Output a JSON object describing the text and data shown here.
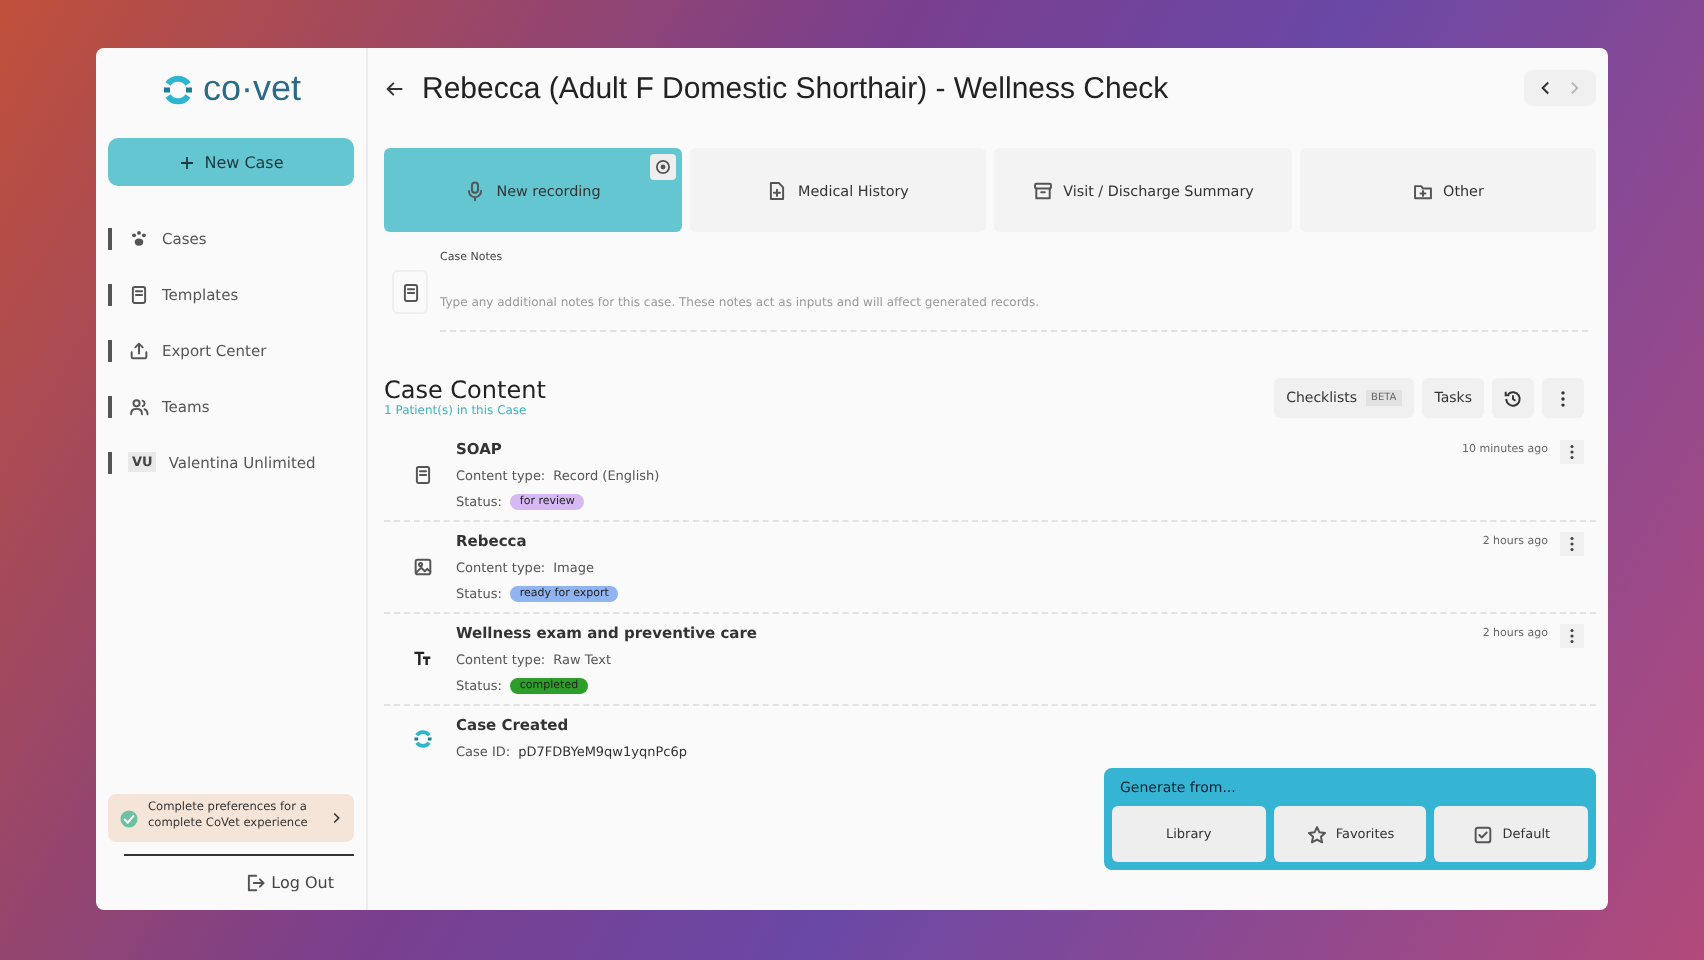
{
  "sidebar": {
    "logo": "co·vet",
    "new_case": "New Case",
    "items": [
      {
        "label": "Cases",
        "kind": "paw"
      },
      {
        "label": "Templates",
        "kind": "doc"
      },
      {
        "label": "Export Center",
        "kind": "upload"
      },
      {
        "label": "Teams",
        "kind": "people"
      },
      {
        "label": "Valentina Unlimited",
        "kind": "initials",
        "initials": "VU"
      }
    ],
    "promo": "Complete preferences for a complete CoVet experience",
    "logout": "Log Out"
  },
  "header": {
    "title": "Rebecca (Adult  F Domestic Shorthair) - Wellness Check"
  },
  "actions": [
    {
      "label": "New recording",
      "kind": "mic",
      "selected": true
    },
    {
      "label": "Medical History",
      "kind": "filePlus",
      "selected": false
    },
    {
      "label": "Visit / Discharge Summary",
      "kind": "archive",
      "selected": false
    },
    {
      "label": "Other",
      "kind": "folder",
      "selected": false
    }
  ],
  "notes": {
    "label": "Case Notes",
    "placeholder": "Type any additional notes for this case. These notes act as inputs and will affect generated records."
  },
  "content": {
    "title": "Case Content",
    "subtitle": "1 Patient(s) in this Case",
    "checklists": "Checklists",
    "beta": "BETA",
    "tasks": "Tasks",
    "items": [
      {
        "title": "SOAP",
        "kind": "doc",
        "type_label": "Content type:",
        "type": "Record  (English)",
        "status_label": "Status:",
        "status": "for review",
        "color": "#d6b8f2",
        "time": "10 minutes ago"
      },
      {
        "title": "Rebecca",
        "kind": "image",
        "type_label": "Content type:",
        "type": "Image",
        "status_label": "Status:",
        "status": "ready for export",
        "color": "#8fb4f0",
        "time": "2 hours ago"
      },
      {
        "title": "Wellness exam and preventive care",
        "kind": "text",
        "type_label": "Content type:",
        "type": "Raw Text",
        "status_label": "Status:",
        "status": "completed",
        "color": "#2e9e2a",
        "time": "2 hours ago"
      }
    ],
    "created": {
      "title": "Case Created",
      "id_label": "Case ID:",
      "id": "pD7FDBYeM9qw1yqnPc6p"
    }
  },
  "generate": {
    "title": "Generate from...",
    "buttons": [
      {
        "label": "Library",
        "kind": "none"
      },
      {
        "label": "Favorites",
        "kind": "star"
      },
      {
        "label": "Default",
        "kind": "check"
      }
    ]
  }
}
